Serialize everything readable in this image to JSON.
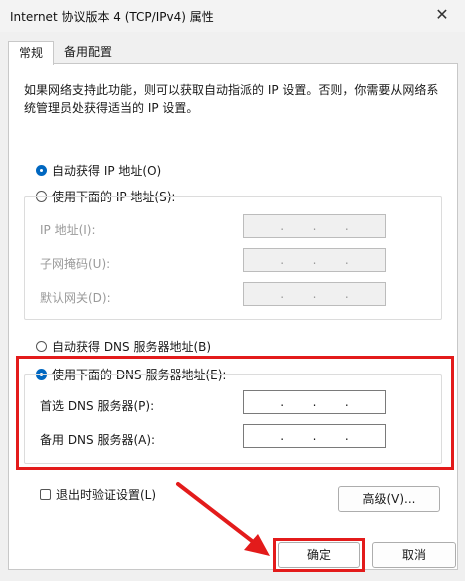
{
  "window": {
    "title": "Internet 协议版本 4 (TCP/IPv4) 属性",
    "close_glyph": "✕"
  },
  "tabs": [
    {
      "label": "常规"
    },
    {
      "label": "备用配置"
    }
  ],
  "description": "如果网络支持此功能，则可以获取自动指派的 IP 设置。否则，你需要从网络系统管理员处获得适当的 IP 设置。",
  "ip_section": {
    "auto_label": "自动获得 IP 地址(O)",
    "manual_label": "使用下面的 IP 地址(S):",
    "selected": "auto",
    "fields": [
      {
        "label": "IP 地址(I):",
        "dots": "."
      },
      {
        "label": "子网掩码(U):",
        "dots": "."
      },
      {
        "label": "默认网关(D):",
        "dots": "."
      }
    ]
  },
  "dns_section": {
    "auto_label": "自动获得 DNS 服务器地址(B)",
    "manual_label": "使用下面的 DNS 服务器地址(E):",
    "selected": "manual",
    "fields": [
      {
        "label": "首选 DNS 服务器(P):",
        "dots": "."
      },
      {
        "label": "备用 DNS 服务器(A):",
        "dots": "."
      }
    ]
  },
  "validate_label": "退出时验证设置(L)",
  "advanced_label": "高级(V)...",
  "ok_label": "确定",
  "cancel_label": "取消",
  "colors": {
    "accent": "#0067c0",
    "highlight": "#e31b1b"
  }
}
